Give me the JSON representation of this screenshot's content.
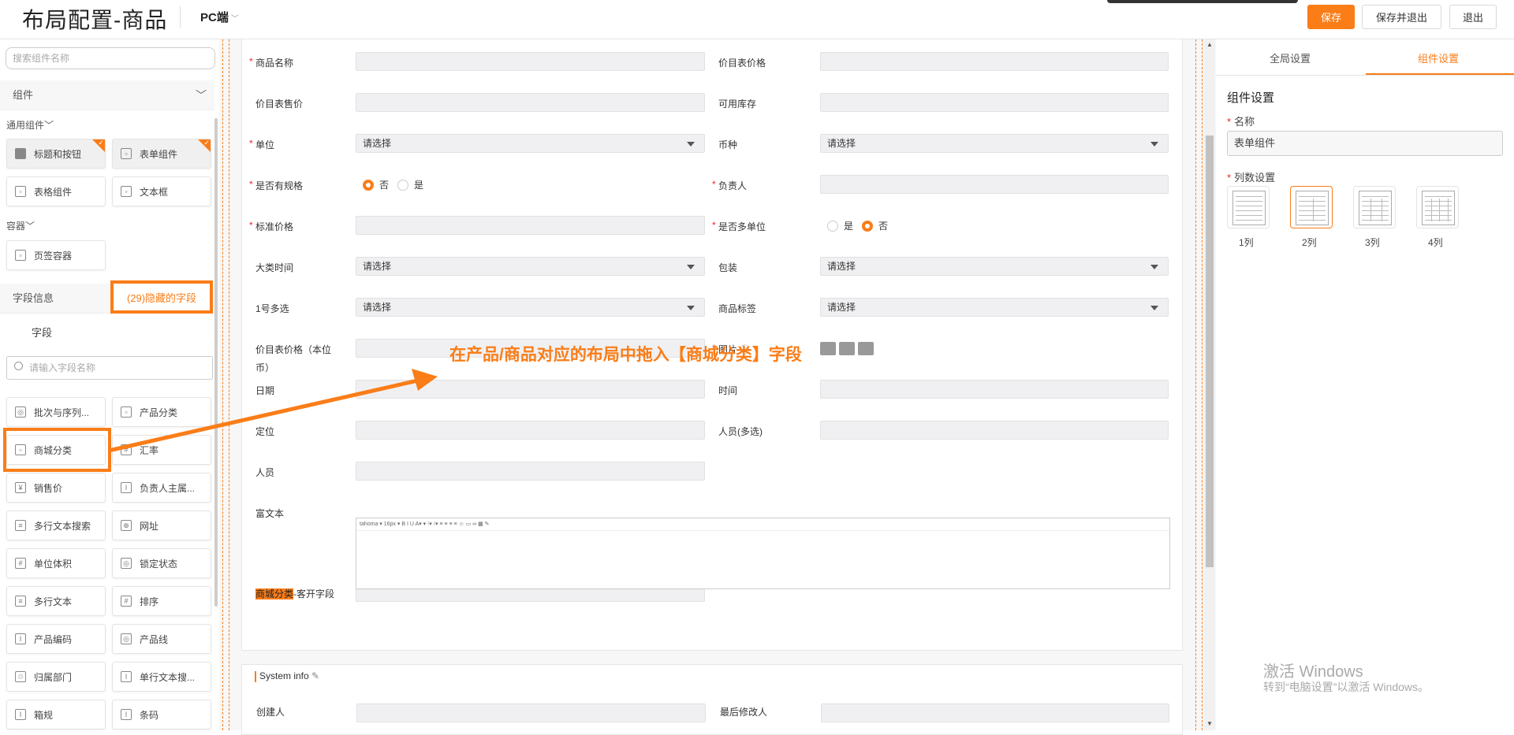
{
  "header": {
    "title": "布局配置-商品",
    "platform": "PC端",
    "save": "保存",
    "save_exit": "保存并退出",
    "exit": "退出"
  },
  "left": {
    "search_placeholder": "搜索组件名称",
    "components_section": "组件",
    "common_group": "通用组件",
    "container_group": "容器",
    "components": [
      {
        "label": "标题和按钮",
        "used": true
      },
      {
        "label": "表单组件",
        "used": true
      },
      {
        "label": "表格组件",
        "used": false
      },
      {
        "label": "文本框",
        "used": false
      }
    ],
    "containers": [
      {
        "label": "页签容器"
      }
    ],
    "field_section": "字段信息",
    "tab_fields": "字段",
    "tab_hidden": "(29)隐藏的字段",
    "field_search_placeholder": "请输入字段名称",
    "fields": [
      {
        "label": "批次与序列...",
        "icon": "target-icon"
      },
      {
        "label": "产品分类",
        "icon": "category-icon"
      },
      {
        "label": "商城分类",
        "icon": "category-icon"
      },
      {
        "label": "汇率",
        "icon": "hash-icon"
      },
      {
        "label": "销售价",
        "icon": "yen-icon"
      },
      {
        "label": "负责人主属...",
        "icon": "text-icon"
      },
      {
        "label": "多行文本搜索",
        "icon": "textarea-icon"
      },
      {
        "label": "网址",
        "icon": "globe-icon"
      },
      {
        "label": "单位体积",
        "icon": "hash-icon"
      },
      {
        "label": "锁定状态",
        "icon": "target-icon"
      },
      {
        "label": "多行文本",
        "icon": "textarea-icon"
      },
      {
        "label": "排序",
        "icon": "hash-icon"
      },
      {
        "label": "产品编码",
        "icon": "text-icon"
      },
      {
        "label": "产品线",
        "icon": "target-icon"
      },
      {
        "label": "归属部门",
        "icon": "dept-icon"
      },
      {
        "label": "单行文本搜...",
        "icon": "text-icon"
      },
      {
        "label": "箱规",
        "icon": "text-icon"
      },
      {
        "label": "条码",
        "icon": "text-icon"
      }
    ]
  },
  "form": {
    "fields": [
      {
        "label": "商品名称",
        "required": true
      },
      {
        "label": "价目表价格",
        "required": false
      },
      {
        "label": "价目表售价",
        "required": false
      },
      {
        "label": "可用库存",
        "required": false
      },
      {
        "label": "单位",
        "required": true,
        "value": "请选择"
      },
      {
        "label": "币种",
        "required": false,
        "value": "请选择"
      },
      {
        "label": "是否有规格",
        "required": true,
        "options": [
          "否",
          "是"
        ],
        "selected": "否"
      },
      {
        "label": "负责人",
        "required": true
      },
      {
        "label": "标准价格",
        "required": true
      },
      {
        "label": "是否多单位",
        "required": true,
        "options": [
          "是",
          "否"
        ],
        "selected": "否"
      },
      {
        "label": "大类时间",
        "required": false,
        "value": "请选择"
      },
      {
        "label": "包装",
        "required": false,
        "value": "请选择"
      },
      {
        "label": "1号多选",
        "required": false,
        "value": "请选择"
      },
      {
        "label": "商品标签",
        "required": false,
        "value": "请选择"
      },
      {
        "label": "价目表价格（本位",
        "label2": "币）",
        "required": false
      },
      {
        "label": "图片",
        "required": true
      },
      {
        "label": "日期",
        "required": false
      },
      {
        "label": "时间",
        "required": false
      },
      {
        "label": "定位",
        "required": false
      },
      {
        "label": "人员(多选)",
        "required": false
      },
      {
        "label": "人员",
        "required": false
      },
      {
        "label": "富文本",
        "required": false
      },
      {
        "label_hl": "商城分类",
        "label_rest": "-客开字段"
      }
    ],
    "richtext_toolbar": "tahoma ▾ 16px ▾  B I U A▾ ▾ ⁝▾ ⁝▾  ≡ ≡ ≡ ≡  ☺ ▭ ∞  ▦  ✎"
  },
  "system_info": {
    "title": "System info",
    "fields": [
      "创建人",
      "最后修改人"
    ]
  },
  "annotation": "在产品/商品对应的布局中拖入【商城分类】字段",
  "right": {
    "tab_global": "全局设置",
    "tab_component": "组件设置",
    "section_title": "组件设置",
    "name_label": "名称",
    "name_value": "表单组件",
    "columns_label": "列数设置",
    "columns": [
      "1列",
      "2列",
      "3列",
      "4列"
    ],
    "selected_columns": "2列"
  },
  "watermark": {
    "line1": "激活 Windows",
    "line2": "转到“电脑设置”以激活 Windows。"
  },
  "colors": {
    "accent": "#fa7d18",
    "required": "#f5222d"
  }
}
